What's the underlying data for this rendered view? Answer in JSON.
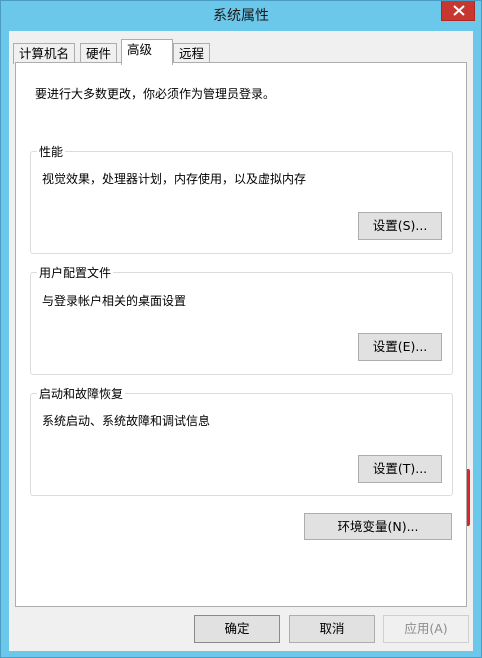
{
  "window": {
    "title": "系统属性"
  },
  "tabs": [
    "计算机名",
    "硬件",
    "高级",
    "远程"
  ],
  "notice": "要进行大多数更改，你必须作为管理员登录。",
  "performance": {
    "title": "性能",
    "desc": "视觉效果，处理器计划，内存使用，以及虚拟内存",
    "button": "设置(S)..."
  },
  "profiles": {
    "title": "用户配置文件",
    "desc": "与登录帐户相关的桌面设置",
    "button": "设置(E)..."
  },
  "startup": {
    "title": "启动和故障恢复",
    "desc": "系统启动、系统故障和调试信息",
    "button": "设置(T)..."
  },
  "env_button": "环境变量(N)...",
  "footer": {
    "ok": "确定",
    "cancel": "取消",
    "apply": "应用(A)"
  },
  "colors": {
    "title_bar": "#6cc8ea",
    "close": "#c7372f",
    "annotation": "#e0232b"
  },
  "icons": [
    "close-icon",
    "annotation-arrow-icon"
  ]
}
